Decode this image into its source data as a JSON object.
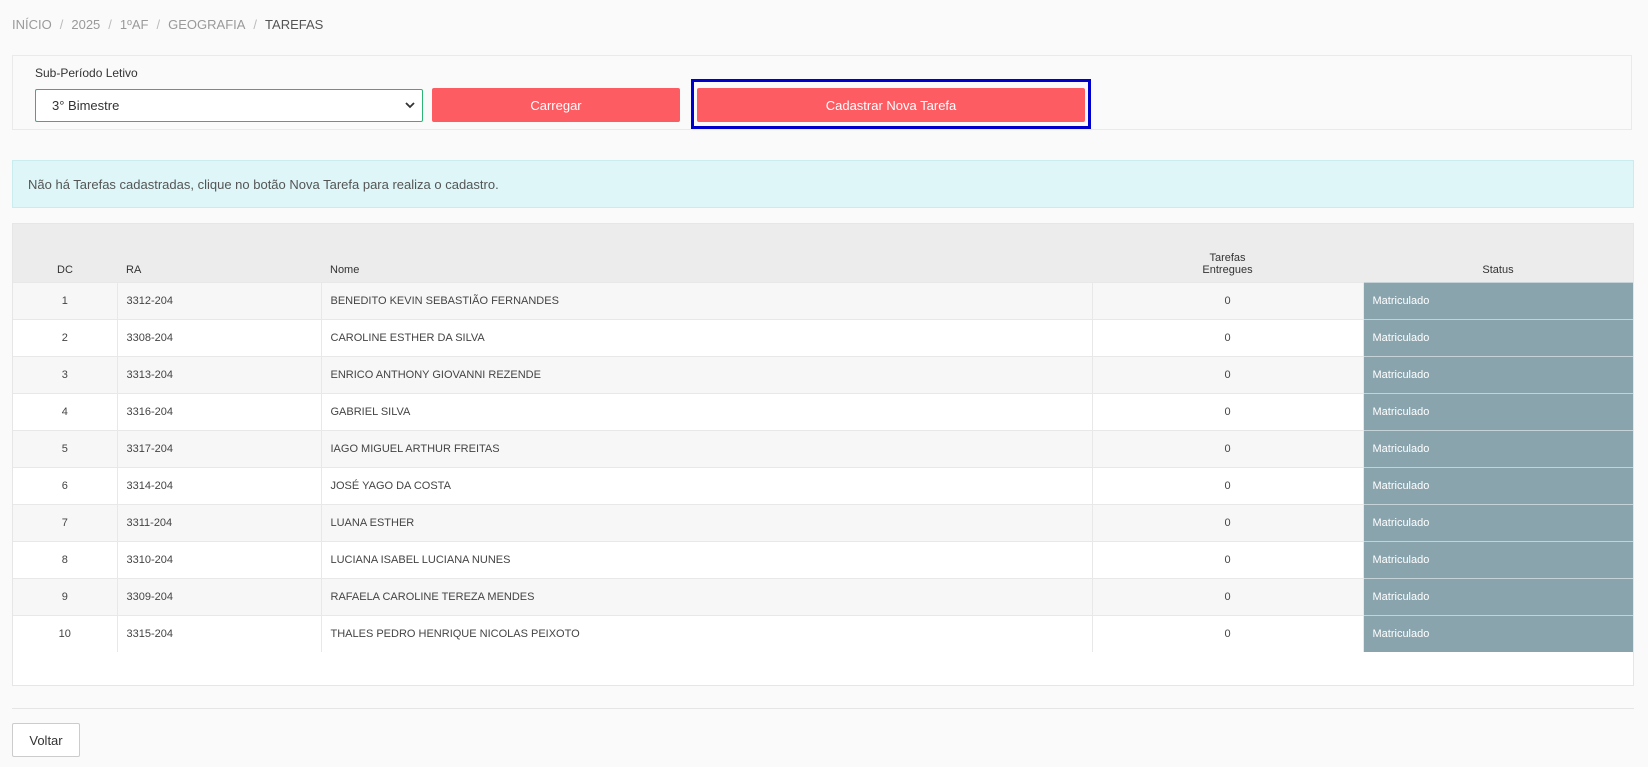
{
  "breadcrumb": [
    {
      "label": "INÍCIO"
    },
    {
      "label": "2025"
    },
    {
      "label": "1ºAF"
    },
    {
      "label": "GEOGRAFIA"
    },
    {
      "label": "TAREFAS"
    }
  ],
  "breadcrumb_separator": "/",
  "filter": {
    "label": "Sub-Período Letivo",
    "selected": "3° Bimestre",
    "load_button": "Carregar",
    "new_task_button": "Cadastrar Nova Tarefa"
  },
  "alert": {
    "text": "Não há Tarefas cadastradas, clique no botão Nova Tarefa para realiza o cadastro."
  },
  "table": {
    "headers": {
      "dc": "DC",
      "ra": "RA",
      "nome": "Nome",
      "tarefas_line1": "Tarefas",
      "tarefas_line2": "Entregues",
      "status": "Status"
    },
    "rows": [
      {
        "dc": "1",
        "ra": "3312-204",
        "nome": "BENEDITO KEVIN SEBASTIÃO FERNANDES",
        "tarefas": "0",
        "status": "Matriculado"
      },
      {
        "dc": "2",
        "ra": "3308-204",
        "nome": "CAROLINE ESTHER DA SILVA",
        "tarefas": "0",
        "status": "Matriculado"
      },
      {
        "dc": "3",
        "ra": "3313-204",
        "nome": "ENRICO ANTHONY GIOVANNI REZENDE",
        "tarefas": "0",
        "status": "Matriculado"
      },
      {
        "dc": "4",
        "ra": "3316-204",
        "nome": "GABRIEL SILVA",
        "tarefas": "0",
        "status": "Matriculado"
      },
      {
        "dc": "5",
        "ra": "3317-204",
        "nome": "IAGO MIGUEL ARTHUR FREITAS",
        "tarefas": "0",
        "status": "Matriculado"
      },
      {
        "dc": "6",
        "ra": "3314-204",
        "nome": "JOSÉ YAGO DA COSTA",
        "tarefas": "0",
        "status": "Matriculado"
      },
      {
        "dc": "7",
        "ra": "3311-204",
        "nome": "LUANA ESTHER",
        "tarefas": "0",
        "status": "Matriculado"
      },
      {
        "dc": "8",
        "ra": "3310-204",
        "nome": "LUCIANA ISABEL LUCIANA NUNES",
        "tarefas": "0",
        "status": "Matriculado"
      },
      {
        "dc": "9",
        "ra": "3309-204",
        "nome": "RAFAELA CAROLINE TEREZA MENDES",
        "tarefas": "0",
        "status": "Matriculado"
      },
      {
        "dc": "10",
        "ra": "3315-204",
        "nome": "THALES PEDRO HENRIQUE NICOLAS PEIXOTO",
        "tarefas": "0",
        "status": "Matriculado"
      }
    ]
  },
  "footer": {
    "back_button": "Voltar"
  },
  "colors": {
    "primary_button": "#fd5c63",
    "status_badge": "#8aa4ae",
    "alert_bg": "#def6f7",
    "highlight_border": "#0000cc",
    "select_border": "#2bb673"
  }
}
